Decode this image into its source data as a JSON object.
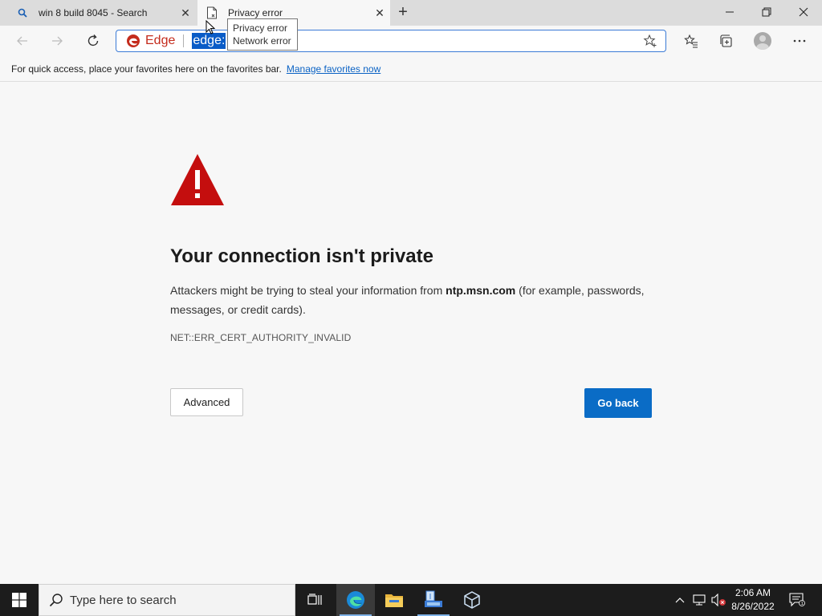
{
  "tabs": [
    {
      "title": "win 8 build 8045 - Search",
      "close": "✕"
    },
    {
      "title": "Privacy error",
      "close": "✕"
    }
  ],
  "new_tab": "+",
  "tooltip": {
    "line1": "Privacy error",
    "line2": "Network error"
  },
  "omnibox": {
    "brand": "Edge",
    "url_fragment": "edge:"
  },
  "favorites_bar": {
    "message": "For quick access, place your favorites here on the favorites bar.",
    "link": "Manage favorites now"
  },
  "error_page": {
    "heading": "Your connection isn't private",
    "desc_before": "Attackers might be trying to steal your information from ",
    "domain": "ntp.msn.com",
    "desc_after": " (for example, passwords, messages, or credit cards).",
    "error_code": "NET::ERR_CERT_AUTHORITY_INVALID",
    "advanced_label": "Advanced",
    "go_back_label": "Go back"
  },
  "taskbar": {
    "search_placeholder": "Type here to search",
    "time": "2:06 AM",
    "date": "8/26/2022"
  },
  "colors": {
    "warning_red": "#c40e0e",
    "primary_blue": "#0a6cc6",
    "link_blue": "#0a62c4"
  }
}
